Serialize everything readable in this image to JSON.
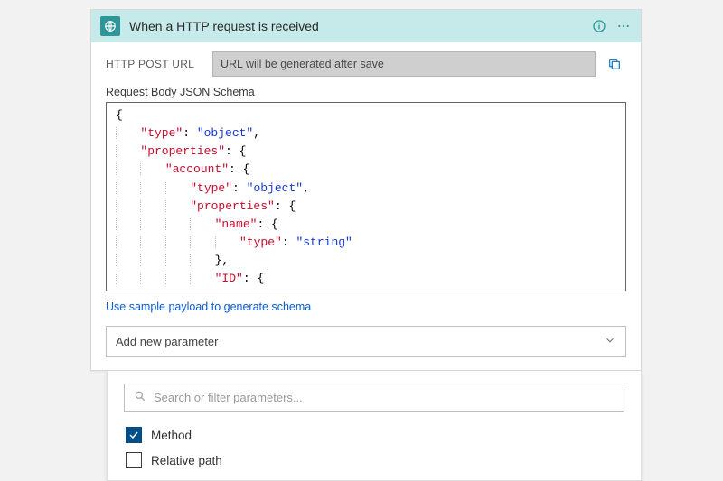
{
  "header": {
    "title": "When a HTTP request is received"
  },
  "postUrl": {
    "label": "HTTP POST URL",
    "value": "URL will be generated after save"
  },
  "schema": {
    "label": "Request Body JSON Schema",
    "lines": [
      {
        "indent": 0,
        "key": null,
        "val": null,
        "raw": "{"
      },
      {
        "indent": 1,
        "key": "type",
        "val": "object",
        "trail": ","
      },
      {
        "indent": 1,
        "key": "properties",
        "val": null,
        "raw": "{"
      },
      {
        "indent": 2,
        "key": "account",
        "val": null,
        "raw": "{"
      },
      {
        "indent": 3,
        "key": "type",
        "val": "object",
        "trail": ","
      },
      {
        "indent": 3,
        "key": "properties",
        "val": null,
        "raw": "{"
      },
      {
        "indent": 4,
        "key": "name",
        "val": null,
        "raw": "{"
      },
      {
        "indent": 5,
        "key": "type",
        "val": "string",
        "trail": ""
      },
      {
        "indent": 4,
        "key": null,
        "val": null,
        "raw": "},"
      },
      {
        "indent": 4,
        "key": "ID",
        "val": null,
        "raw": "{",
        "partial": true
      }
    ]
  },
  "sampleLink": "Use sample payload to generate schema",
  "addParam": {
    "label": "Add new parameter"
  },
  "paramPanel": {
    "searchPlaceholder": "Search or filter parameters...",
    "options": [
      {
        "label": "Method",
        "checked": true
      },
      {
        "label": "Relative path",
        "checked": false
      }
    ]
  }
}
